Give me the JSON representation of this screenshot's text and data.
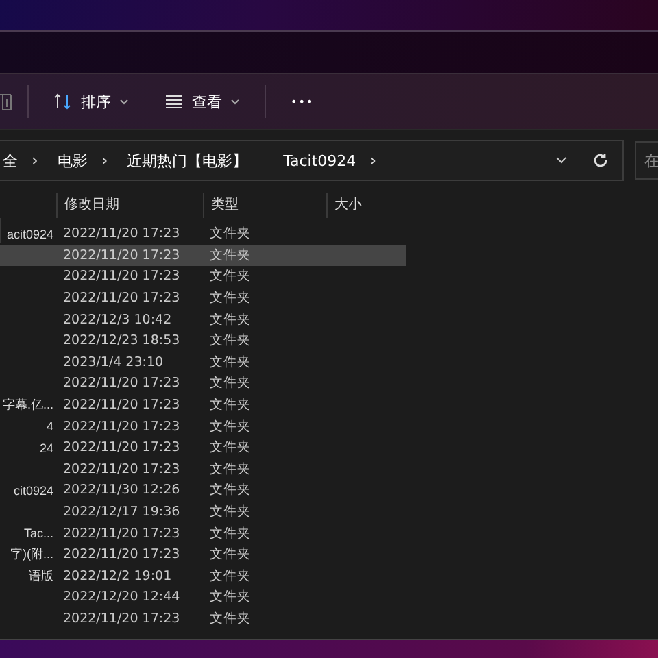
{
  "toolbar": {
    "buttons": [
      {
        "kind": "sort",
        "label": "排序"
      },
      {
        "kind": "view",
        "label": "查看"
      }
    ],
    "more": "•••"
  },
  "address_bar": {
    "crumbs": [
      {
        "label": "全",
        "arrow": "›"
      },
      {
        "label": "电影",
        "arrow": "›"
      },
      {
        "label": "近期热门【电影】"
      },
      {
        "label": "Tacit0924",
        "arrow": "›"
      }
    ]
  },
  "search": {
    "placeholder": "在"
  },
  "table": {
    "columns": [
      "修改日期",
      "类型",
      "大小"
    ],
    "rows": [
      {
        "name": "acit0924",
        "modified": "2022/11/20 17:23",
        "type": "文件夹",
        "selected": false
      },
      {
        "modified": "2022/11/20 17:23",
        "type": "文件夹",
        "selected": true
      },
      {
        "modified": "2022/11/20 17:23",
        "type": "文件夹",
        "selected": false
      },
      {
        "modified": "2022/11/20 17:23",
        "type": "文件夹",
        "selected": false
      },
      {
        "modified": "2022/12/3 10:42",
        "type": "文件夹",
        "selected": false
      },
      {
        "modified": "2022/12/23 18:53",
        "type": "文件夹",
        "selected": false
      },
      {
        "modified": "2023/1/4 23:10",
        "type": "文件夹",
        "selected": false
      },
      {
        "modified": "2022/11/20 17:23",
        "type": "文件夹",
        "selected": false
      },
      {
        "name": "字幕.亿...",
        "modified": "2022/11/20 17:23",
        "type": "文件夹",
        "selected": false
      },
      {
        "name": "4",
        "modified": "2022/11/20 17:23",
        "type": "文件夹",
        "selected": false
      },
      {
        "name": "24",
        "modified": "2022/11/20 17:23",
        "type": "文件夹",
        "selected": false
      },
      {
        "modified": "2022/11/20 17:23",
        "type": "文件夹",
        "selected": false
      },
      {
        "name": "cit0924",
        "modified": "2022/11/30 12:26",
        "type": "文件夹",
        "selected": false
      },
      {
        "modified": "2022/12/17 19:36",
        "type": "文件夹",
        "selected": false
      },
      {
        "name": "Tac...",
        "modified": "2022/11/20 17:23",
        "type": "文件夹",
        "selected": false
      },
      {
        "name": "字)(附...",
        "modified": "2022/11/20 17:23",
        "type": "文件夹",
        "selected": false
      },
      {
        "name": "语版",
        "modified": "2022/12/2 19:01",
        "type": "文件夹",
        "selected": false
      },
      {
        "modified": "2022/12/20 12:44",
        "type": "文件夹",
        "selected": false
      },
      {
        "modified": "2022/11/20 17:23",
        "type": "文件夹",
        "selected": false
      }
    ]
  }
}
